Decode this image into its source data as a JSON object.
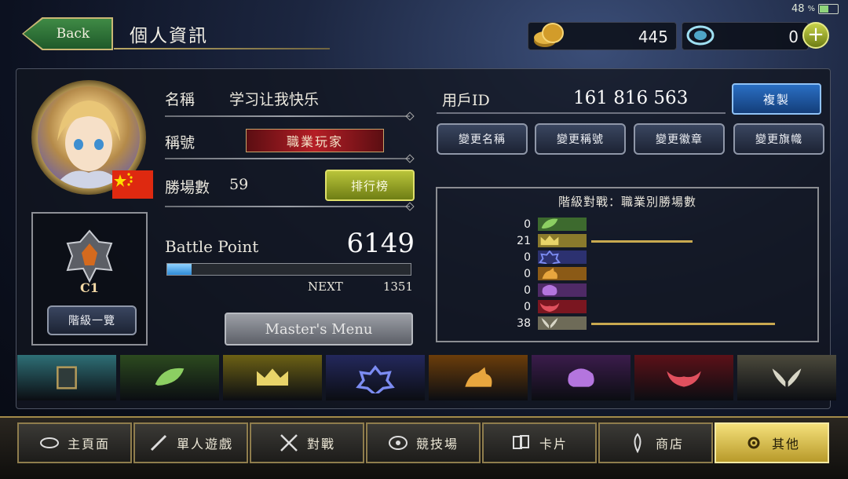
{
  "status": {
    "battery": "48",
    "percent": "%"
  },
  "header": {
    "back_label": "Back",
    "title": "個人資訊"
  },
  "currency": {
    "coins": "445",
    "crystals": "0"
  },
  "profile": {
    "name_label": "名稱",
    "name_value": "学习让我快乐",
    "title_label": "稱號",
    "title_value": "職業玩家",
    "wins_label": "勝場數",
    "wins_value": "59",
    "leaderboard_label": "排行榜",
    "rank": "C1",
    "rank_list_label": "階級一覽",
    "bp_label": "Battle Point",
    "bp_value": "6149",
    "bp_progress": 0.1,
    "next_label": "NEXT",
    "next_value": "1351",
    "master_label": "Master's Menu"
  },
  "account": {
    "uid_label": "用戶ID",
    "uid_value": "161 816 563",
    "copy_label": "複製",
    "change_buttons": [
      "變更名稱",
      "變更稱號",
      "變更徽章",
      "變更旗幟"
    ]
  },
  "stats": {
    "title": "階級對戰：職業別勝場數",
    "rows": [
      {
        "value": "0",
        "color": "#3d6a2e",
        "icon": "leaf-icon"
      },
      {
        "value": "21",
        "color": "#8a7a2c",
        "icon": "crown-icon"
      },
      {
        "value": "0",
        "color": "#2c3170",
        "icon": "star-icon"
      },
      {
        "value": "0",
        "color": "#8b5a16",
        "icon": "dragon-icon"
      },
      {
        "value": "0",
        "color": "#4f2a66",
        "icon": "skull-icon"
      },
      {
        "value": "0",
        "color": "#7a1620",
        "icon": "bat-icon"
      },
      {
        "value": "38",
        "color": "#6e6b58",
        "icon": "wings-icon"
      }
    ],
    "max": 38
  },
  "class_tabs": [
    {
      "icon": "card-icon",
      "color": "#2e6f76"
    },
    {
      "icon": "leaf-icon",
      "color": "#2c4a1f"
    },
    {
      "icon": "crown-icon",
      "color": "#6c6114"
    },
    {
      "icon": "star-icon",
      "color": "#23285c"
    },
    {
      "icon": "dragon-icon",
      "color": "#6b3d0a"
    },
    {
      "icon": "skull-icon",
      "color": "#3b1c4c"
    },
    {
      "icon": "bat-icon",
      "color": "#5c1118"
    },
    {
      "icon": "wings-icon",
      "color": "#4c4a3c"
    }
  ],
  "nav": [
    {
      "label": "主頁面",
      "icon": "home-icon"
    },
    {
      "label": "單人遊戲",
      "icon": "sword-icon"
    },
    {
      "label": "對戰",
      "icon": "crossed-swords-icon"
    },
    {
      "label": "競技場",
      "icon": "arena-icon"
    },
    {
      "label": "卡片",
      "icon": "cards-icon"
    },
    {
      "label": "商店",
      "icon": "shop-icon"
    },
    {
      "label": "其他",
      "icon": "settings-icon"
    }
  ]
}
